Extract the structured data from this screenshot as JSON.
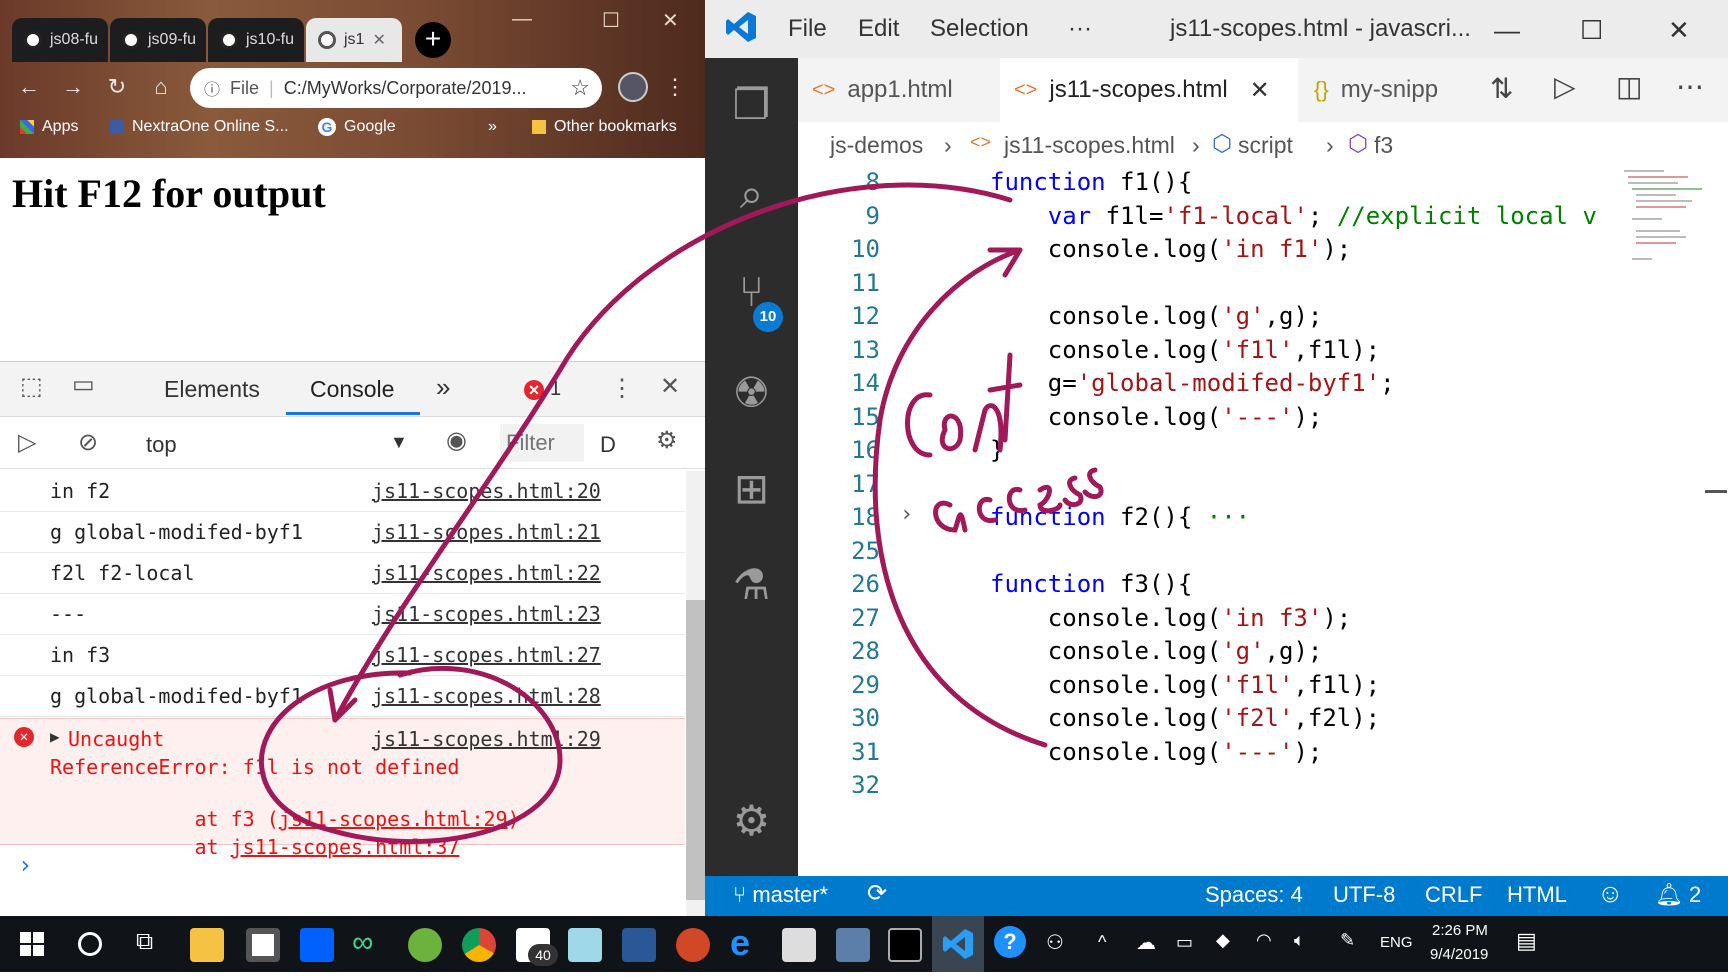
{
  "chrome": {
    "tabs": [
      {
        "label": "js08-fu"
      },
      {
        "label": "js09-fu"
      },
      {
        "label": "js10-fu"
      },
      {
        "label": "js1",
        "active": true
      }
    ],
    "new_tab": "+",
    "address": "C:/MyWorks/Corporate/2019...",
    "address_scheme": "File",
    "bookmarks": [
      "Apps",
      "NextraOne Online S...",
      "Google"
    ],
    "bookmarks_more": "»",
    "other_bookmarks": "Other bookmarks",
    "page_heading": "Hit F12 for output"
  },
  "devtools": {
    "tabs": [
      "Elements",
      "Console"
    ],
    "more": "»",
    "error_count": "1",
    "context": "top",
    "filter_placeholder": "Filter",
    "levels_label": "D",
    "console_rows": [
      {
        "msg": "in f2",
        "src": "js11-scopes.html:20"
      },
      {
        "msg": "g global-modifed-byf1",
        "src": "js11-scopes.html:21"
      },
      {
        "msg": "f2l f2-local",
        "src": "js11-scopes.html:22"
      },
      {
        "msg": "---",
        "src": "js11-scopes.html:23"
      },
      {
        "msg": "in f3",
        "src": "js11-scopes.html:27"
      },
      {
        "msg": "g global-modifed-byf1",
        "src": "js11-scopes.html:28"
      }
    ],
    "error": {
      "line1": "Uncaught",
      "line2": "ReferenceError: f1l is not defined",
      "line3_prefix": "    at f3 (",
      "line3_link": "js11-scopes.html:29",
      "line3_suffix": ")",
      "line4_prefix": "    at ",
      "line4_link": "js11-scopes.html:37",
      "src": "js11-scopes.html:29"
    },
    "prompt": "›"
  },
  "vscode": {
    "menus": [
      "File",
      "Edit",
      "Selection",
      "···"
    ],
    "title": "js11-scopes.html - javascri...",
    "tabs": [
      {
        "label": "app1.html",
        "icon": "<>"
      },
      {
        "label": "js11-scopes.html",
        "icon": "<>",
        "active": true,
        "close": "✕"
      },
      {
        "label": "my-snipp",
        "icon": "{}"
      }
    ],
    "breadcrumb": [
      "js-demos",
      "js11-scopes.html",
      "script",
      "f3"
    ],
    "scm_badge": "10",
    "code_lines": [
      {
        "n": "8",
        "parts": [
          [
            "kw",
            "function"
          ],
          [
            "",
            " f1(){"
          ]
        ]
      },
      {
        "n": "9",
        "parts": [
          [
            "",
            "    "
          ],
          [
            "kw",
            "var"
          ],
          [
            "",
            " f1l="
          ],
          [
            "str",
            "'f1-local'"
          ],
          [
            "",
            "; "
          ],
          [
            "cm",
            "//explicit local v"
          ]
        ]
      },
      {
        "n": "10",
        "parts": [
          [
            "",
            "    console.log("
          ],
          [
            "str",
            "'in f1'"
          ],
          [
            "",
            ");"
          ]
        ]
      },
      {
        "n": "11",
        "parts": [
          [
            "",
            ""
          ]
        ]
      },
      {
        "n": "12",
        "parts": [
          [
            "",
            "    console.log("
          ],
          [
            "str",
            "'g'"
          ],
          [
            "",
            ",g);"
          ]
        ]
      },
      {
        "n": "13",
        "parts": [
          [
            "",
            "    console.log("
          ],
          [
            "str",
            "'f1l'"
          ],
          [
            "",
            ",f1l);"
          ]
        ]
      },
      {
        "n": "14",
        "parts": [
          [
            "",
            "    g="
          ],
          [
            "str",
            "'global-modifed-byf1'"
          ],
          [
            "",
            ";"
          ]
        ]
      },
      {
        "n": "15",
        "parts": [
          [
            "",
            "    console.log("
          ],
          [
            "str",
            "'---'"
          ],
          [
            "",
            ");"
          ]
        ]
      },
      {
        "n": "16",
        "parts": [
          [
            "",
            "}"
          ]
        ]
      },
      {
        "n": "17",
        "parts": [
          [
            "",
            ""
          ]
        ]
      },
      {
        "n": "18",
        "parts": [
          [
            "kw",
            "function"
          ],
          [
            "",
            " f2(){"
          ],
          [
            "cm",
            " ···"
          ]
        ]
      },
      {
        "n": "25",
        "parts": [
          [
            "",
            ""
          ]
        ]
      },
      {
        "n": "26",
        "parts": [
          [
            "kw",
            "function"
          ],
          [
            "",
            " f3(){"
          ]
        ]
      },
      {
        "n": "27",
        "parts": [
          [
            "",
            "    console.log("
          ],
          [
            "str",
            "'in f3'"
          ],
          [
            "",
            ");"
          ]
        ]
      },
      {
        "n": "28",
        "parts": [
          [
            "",
            "    console.log("
          ],
          [
            "str",
            "'g'"
          ],
          [
            "",
            ",g);"
          ]
        ]
      },
      {
        "n": "29",
        "parts": [
          [
            "",
            "    console.log("
          ],
          [
            "str",
            "'f1l'"
          ],
          [
            "",
            ",f1l);"
          ]
        ]
      },
      {
        "n": "30",
        "parts": [
          [
            "",
            "    console.log("
          ],
          [
            "str",
            "'f2l'"
          ],
          [
            "",
            ",f2l);"
          ]
        ]
      },
      {
        "n": "31",
        "parts": [
          [
            "",
            "    console.log("
          ],
          [
            "str",
            "'---'"
          ],
          [
            "",
            ");"
          ]
        ]
      },
      {
        "n": "32",
        "parts": [
          [
            "",
            ""
          ]
        ]
      }
    ],
    "status": {
      "branch": "master*",
      "sync": "⟳",
      "spaces": "Spaces: 4",
      "encoding": "UTF-8",
      "eol": "CRLF",
      "language": "HTML",
      "feedback": "☺",
      "notifications": "2"
    },
    "annotation": "Cant access"
  },
  "taskbar": {
    "mail_badge": "40",
    "lang": "ENG",
    "time": "2:26 PM",
    "date": "9/4/2019"
  },
  "colors": {
    "vs_blue": "#007acc",
    "keyword": "#0000ff",
    "string": "#a31515",
    "comment": "#008000",
    "highlight": "#f26b1d",
    "annotation": "#a01a5a",
    "error_red": "#e0282e"
  }
}
